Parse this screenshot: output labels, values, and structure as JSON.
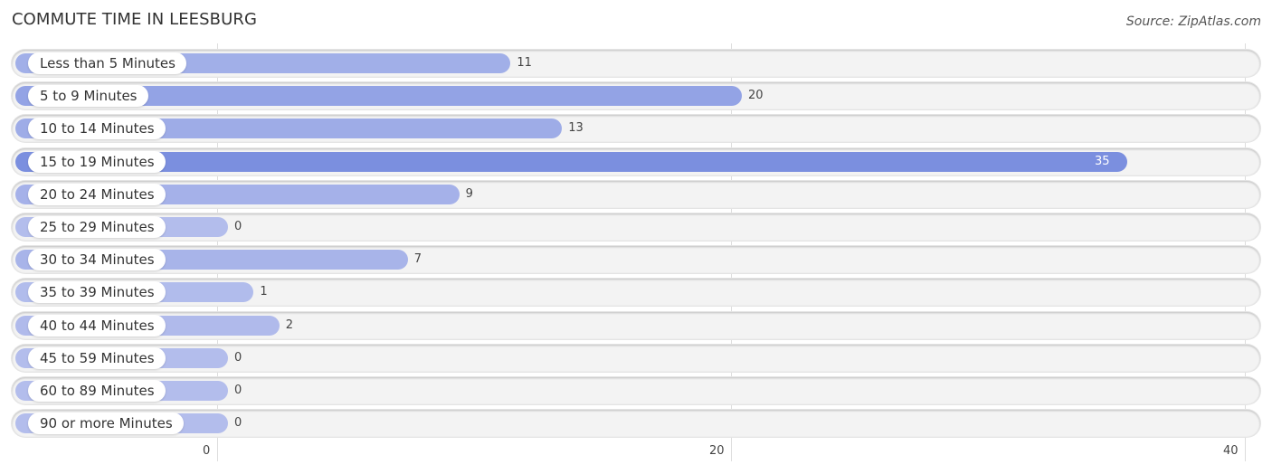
{
  "header": {
    "title": "COMMUTE TIME IN LEESBURG",
    "source": "Source: ZipAtlas.com"
  },
  "chart_data": {
    "type": "bar",
    "orientation": "horizontal",
    "title": "COMMUTE TIME IN LEESBURG",
    "categories": [
      "Less than 5 Minutes",
      "5 to 9 Minutes",
      "10 to 14 Minutes",
      "15 to 19 Minutes",
      "20 to 24 Minutes",
      "25 to 29 Minutes",
      "30 to 34 Minutes",
      "35 to 39 Minutes",
      "40 to 44 Minutes",
      "45 to 59 Minutes",
      "60 to 89 Minutes",
      "90 or more Minutes"
    ],
    "values": [
      11,
      20,
      13,
      35,
      9,
      0,
      7,
      1,
      2,
      0,
      0,
      0
    ],
    "xlabel": "",
    "ylabel": "",
    "xlim": [
      0,
      40
    ],
    "xticks": [
      "0",
      "20",
      "40"
    ],
    "grid": true,
    "colors": {
      "low": "#b3bdec",
      "high": "#7b8fdf",
      "track": "#f3f3f3"
    }
  }
}
